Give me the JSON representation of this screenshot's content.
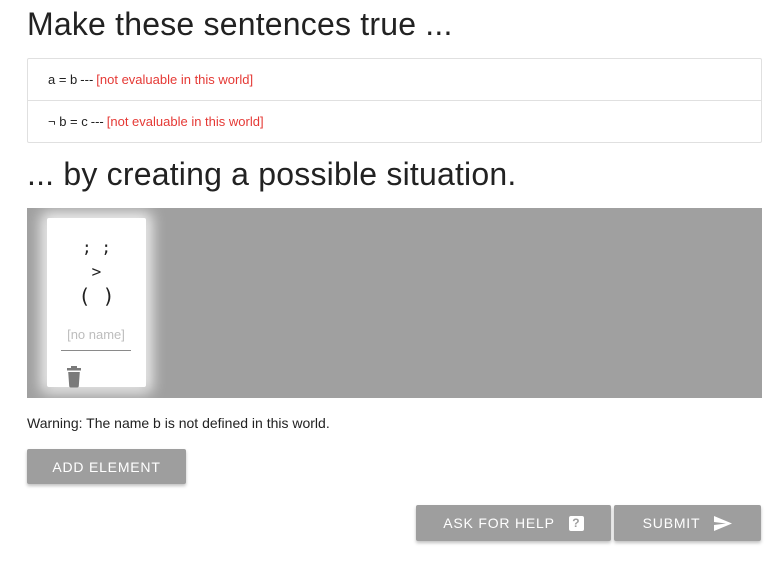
{
  "heading_sentences": "Make these sentences true ...",
  "sentences": [
    {
      "formula": "a = b",
      "separator": "---",
      "status": "[not evaluable in this world]"
    },
    {
      "formula": "¬ b = c",
      "separator": "---",
      "status": "[not evaluable in this world]"
    }
  ],
  "heading_situation": "... by creating a possible situation.",
  "element": {
    "face": {
      "eyes": "; ;",
      "nose": ">",
      "mouth": "( )"
    },
    "name_placeholder": "[no name]",
    "name_value": "",
    "delete_icon": "trash-icon"
  },
  "warning": "Warning: The name b is not defined in this world.",
  "buttons": {
    "add_element": "ADD ELEMENT",
    "ask_for_help": "ASK FOR HELP",
    "ask_for_help_icon": "help-icon",
    "submit": "SUBMIT",
    "submit_icon": "send-icon"
  },
  "colors": {
    "status_red": "#e53935",
    "world_background": "#a0a0a0",
    "button_gray": "#9e9e9e"
  }
}
